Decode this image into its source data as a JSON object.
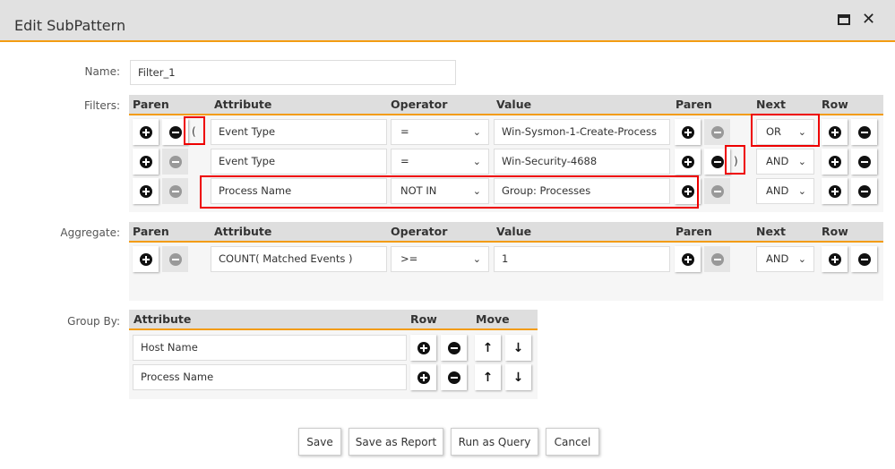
{
  "dialog": {
    "title": "Edit SubPattern",
    "maximize_icon": "window-maximize-icon",
    "close_icon": "close-icon"
  },
  "name": {
    "label": "Name:",
    "value": "Filter_1"
  },
  "filters": {
    "label": "Filters:",
    "headers": {
      "paren_open": "Paren",
      "attribute": "Attribute",
      "operator": "Operator",
      "value": "Value",
      "paren_close": "Paren",
      "next": "Next",
      "row": "Row"
    },
    "rows": [
      {
        "open_paren": "(",
        "attribute": "Event Type",
        "operator": "=",
        "value": "Win-Sysmon-1-Create-Process",
        "close_paren": "",
        "next": "OR",
        "open_minus_enabled": true,
        "close_minus_enabled": false
      },
      {
        "open_paren": "",
        "attribute": "Event Type",
        "operator": "=",
        "value": "Win-Security-4688",
        "close_paren": ")",
        "next": "AND",
        "open_minus_enabled": false,
        "close_minus_enabled": true
      },
      {
        "open_paren": "",
        "attribute": "Process Name",
        "operator": "NOT IN",
        "value": "Group: Processes",
        "close_paren": "",
        "next": "AND",
        "open_minus_enabled": false,
        "close_minus_enabled": false
      }
    ]
  },
  "aggregate": {
    "label": "Aggregate:",
    "headers": {
      "paren_open": "Paren",
      "attribute": "Attribute",
      "operator": "Operator",
      "value": "Value",
      "paren_close": "Paren",
      "next": "Next",
      "row": "Row"
    },
    "rows": [
      {
        "open_paren": "",
        "attribute": "COUNT( Matched Events )",
        "operator": ">=",
        "value": "1",
        "close_paren": "",
        "next": "AND",
        "open_minus_enabled": false,
        "close_minus_enabled": false
      }
    ]
  },
  "group_by": {
    "label": "Group By:",
    "headers": {
      "attribute": "Attribute",
      "row": "Row",
      "move": "Move"
    },
    "rows": [
      {
        "attribute": "Host Name"
      },
      {
        "attribute": "Process Name"
      }
    ]
  },
  "buttons": {
    "save": "Save",
    "save_as_report": "Save as Report",
    "run_as_query": "Run as Query",
    "cancel": "Cancel"
  }
}
